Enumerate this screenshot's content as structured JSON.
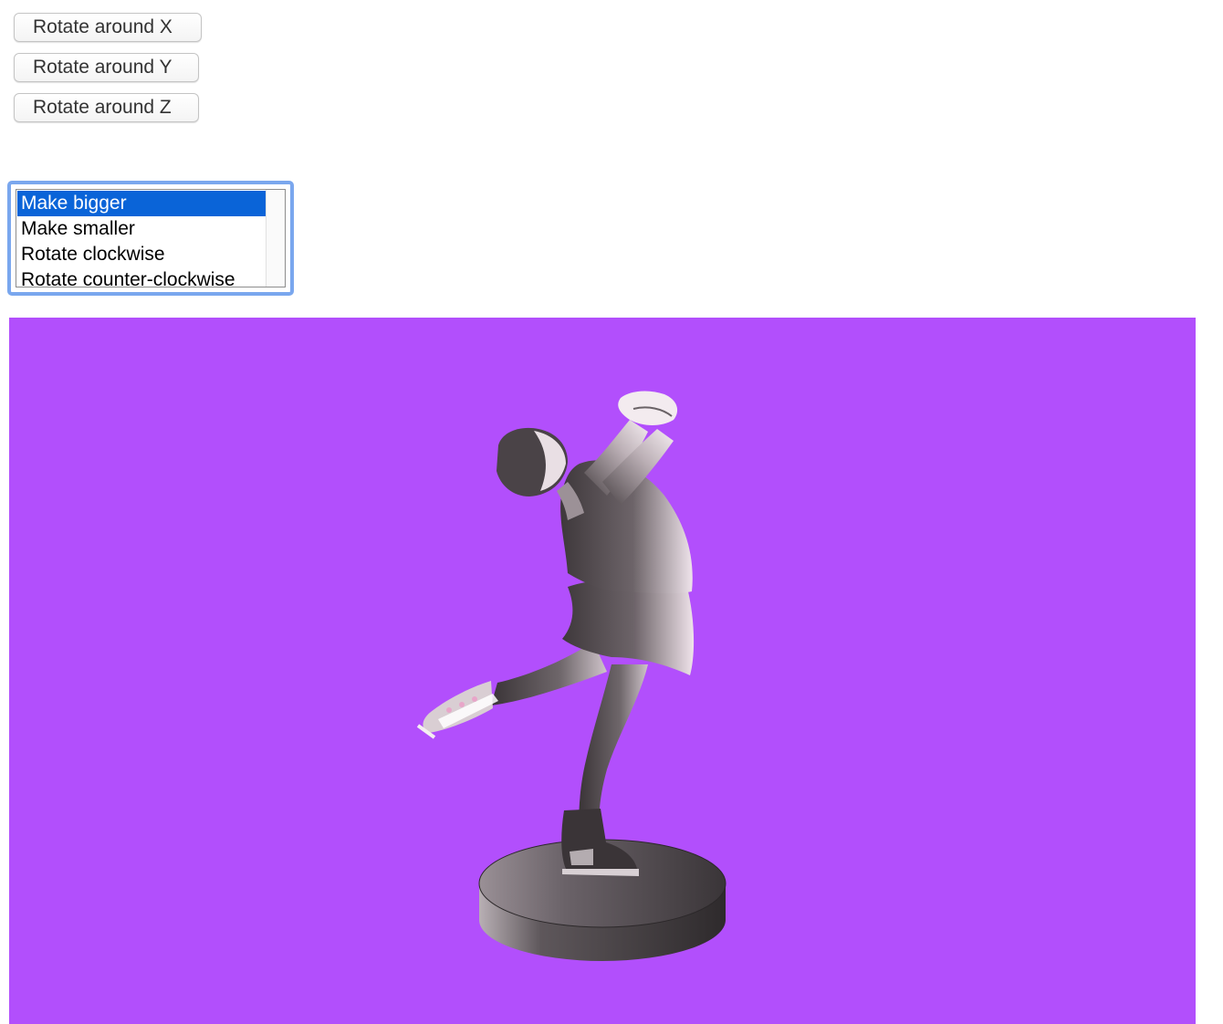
{
  "buttons": {
    "rotate_x": "Rotate around X",
    "rotate_y": "Rotate around Y",
    "rotate_z": "Rotate around Z"
  },
  "listbox": {
    "options": [
      {
        "label": "Make bigger",
        "selected": true
      },
      {
        "label": "Make smaller",
        "selected": false
      },
      {
        "label": "Rotate clockwise",
        "selected": false
      },
      {
        "label": "Rotate counter-clockwise",
        "selected": false
      }
    ],
    "selection_color": "#0a64d8",
    "focus_ring_color": "#7aa7ee"
  },
  "canvas": {
    "background_color": "#b24ffc",
    "subject": "figure-skater-statue",
    "model_color": "#4a4448"
  }
}
